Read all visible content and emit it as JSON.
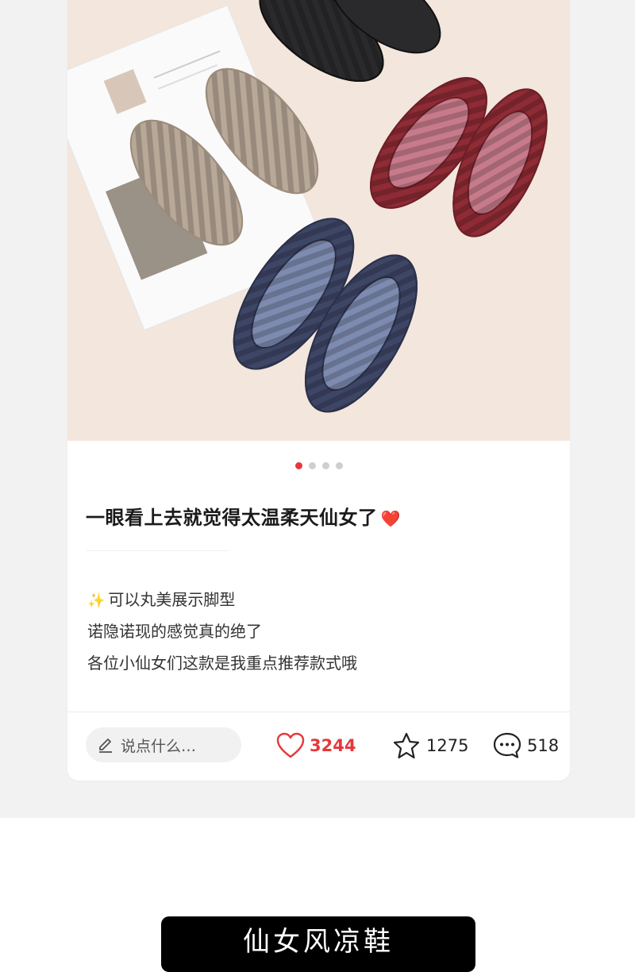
{
  "photo": {
    "alt": "shoes-photo"
  },
  "carousel": {
    "count": 4,
    "active_index": 0
  },
  "post": {
    "title": "一眼看上去就觉得太温柔天仙女了",
    "title_emoji": "❤️",
    "lines": [
      "可以丸美展示脚型",
      "诺隐诺现的感觉真的绝了",
      "各位小仙女们这款是我重点推荐款式哦"
    ],
    "sparkle_emoji": "✨"
  },
  "actions": {
    "comment_placeholder": "说点什么…",
    "likes": "3244",
    "stars": "1275",
    "comments": "518"
  },
  "banner": {
    "text": "仙女风凉鞋"
  },
  "colors": {
    "accent": "#e5383b",
    "card_bg": "#ffffff",
    "page_bg": "#f2f2f2",
    "banner_bg": "#000000"
  }
}
